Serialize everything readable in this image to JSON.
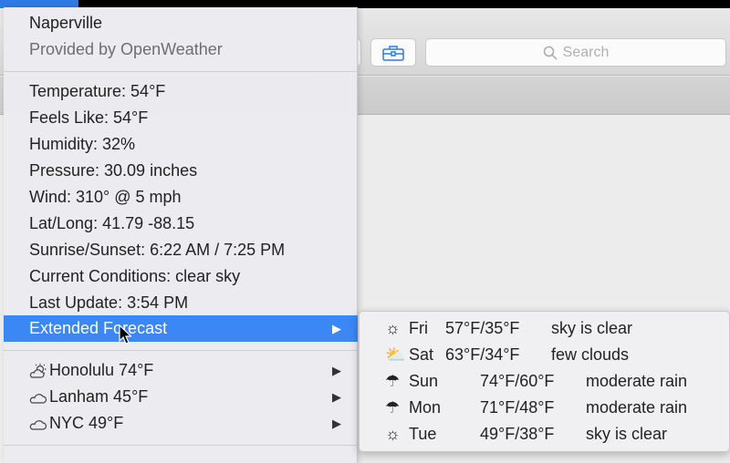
{
  "background_window": {
    "search_placeholder": "Search"
  },
  "menu": {
    "location": "Naperville",
    "provider": "Provided by OpenWeather",
    "details": [
      "Temperature: 54°F",
      "Feels Like: 54°F",
      "Humidity: 32%",
      "Pressure: 30.09 inches",
      "Wind: 310° @ 5 mph",
      "Lat/Long: 41.79 -88.15",
      "Sunrise/Sunset: 6:22 AM / 7:25 PM",
      "Current Conditions: clear sky",
      "Last Update: 3:54 PM"
    ],
    "extended_forecast": "Extended Forecast",
    "cities": [
      {
        "icon": "partly-cloudy-icon",
        "label": "Honolulu 74°F"
      },
      {
        "icon": "cloud-icon",
        "label": "Lanham 45°F"
      },
      {
        "icon": "cloud-icon",
        "label": "NYC 49°F"
      }
    ]
  },
  "forecast": [
    {
      "icon": "sun-icon",
      "day": "Fri",
      "temps": "57°F/35°F",
      "desc": "sky is clear"
    },
    {
      "icon": "partly-cloudy-icon",
      "day": "Sat",
      "temps": "63°F/34°F",
      "desc": "few clouds"
    },
    {
      "icon": "rain-icon",
      "day": "Sun",
      "temps": "74°F/60°F",
      "desc": "moderate rain"
    },
    {
      "icon": "rain-icon",
      "day": "Mon",
      "temps": "71°F/48°F",
      "desc": "moderate rain"
    },
    {
      "icon": "sun-icon",
      "day": "Tue",
      "temps": "49°F/38°F",
      "desc": "sky is clear"
    }
  ],
  "colors": {
    "highlight": "#3a87f5",
    "toolbar_icon": "#2f7ae5"
  }
}
